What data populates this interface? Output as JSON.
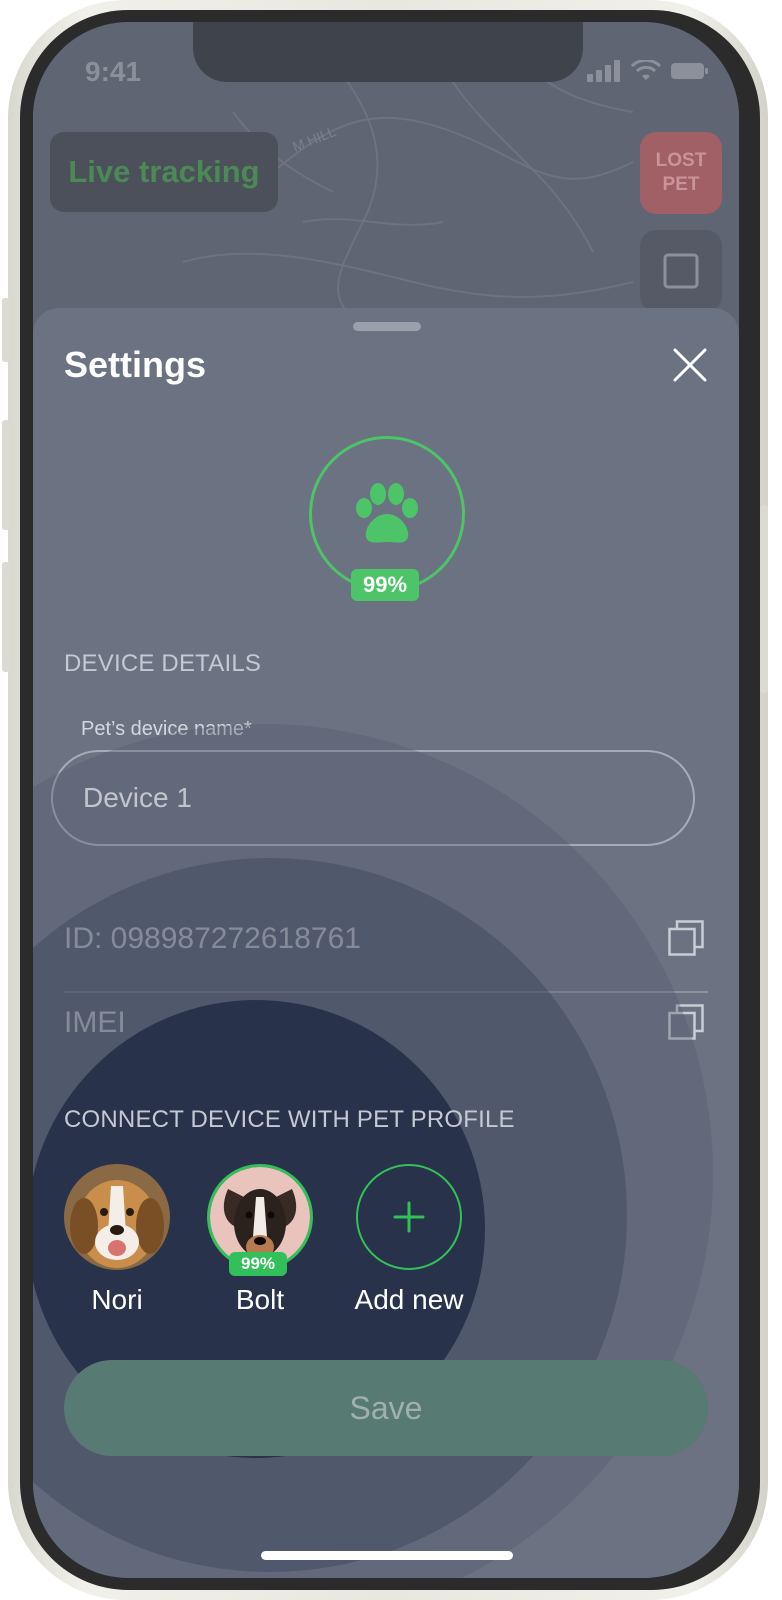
{
  "status_bar": {
    "time": "9:41"
  },
  "map": {
    "live_tracking_label": "Live tracking",
    "lost_pet_label_line1": "LOST",
    "lost_pet_label_line2": "PET",
    "street_label": "M HILL"
  },
  "settings": {
    "title": "Settings",
    "device_battery": "99%",
    "device_details_heading": "DEVICE DETAILS",
    "device_name_label": "Pet’s device name*",
    "device_name_value": "Device 1",
    "id_text": "ID: 098987272618761",
    "imei_text": "IMEI",
    "connect_heading": "CONNECT DEVICE WITH PET PROFILE",
    "pets": [
      {
        "name": "Nori"
      },
      {
        "name": "Bolt",
        "battery": "99%"
      }
    ],
    "add_new_label": "Add new",
    "save_label": "Save"
  },
  "colors": {
    "accent_green": "#4cc467",
    "sheet_bg": "#6b7282",
    "overlay_dark": "#232c45"
  }
}
